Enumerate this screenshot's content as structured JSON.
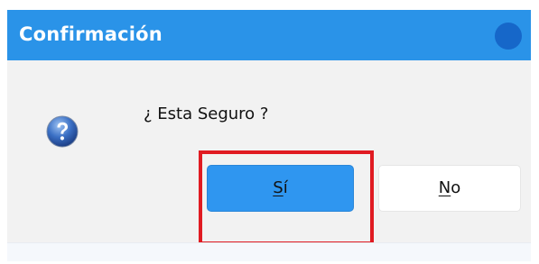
{
  "dialog": {
    "title": "Confirmación",
    "message": "¿ Esta Seguro ?",
    "icon": "question-icon",
    "buttons": {
      "yes": {
        "mnemonic": "S",
        "rest": "í"
      },
      "no": {
        "mnemonic": "N",
        "rest": "o"
      }
    }
  },
  "colors": {
    "titlebar": "#2a93e8",
    "yes_button": "#2f96f0",
    "highlight_box": "#e01b22"
  }
}
